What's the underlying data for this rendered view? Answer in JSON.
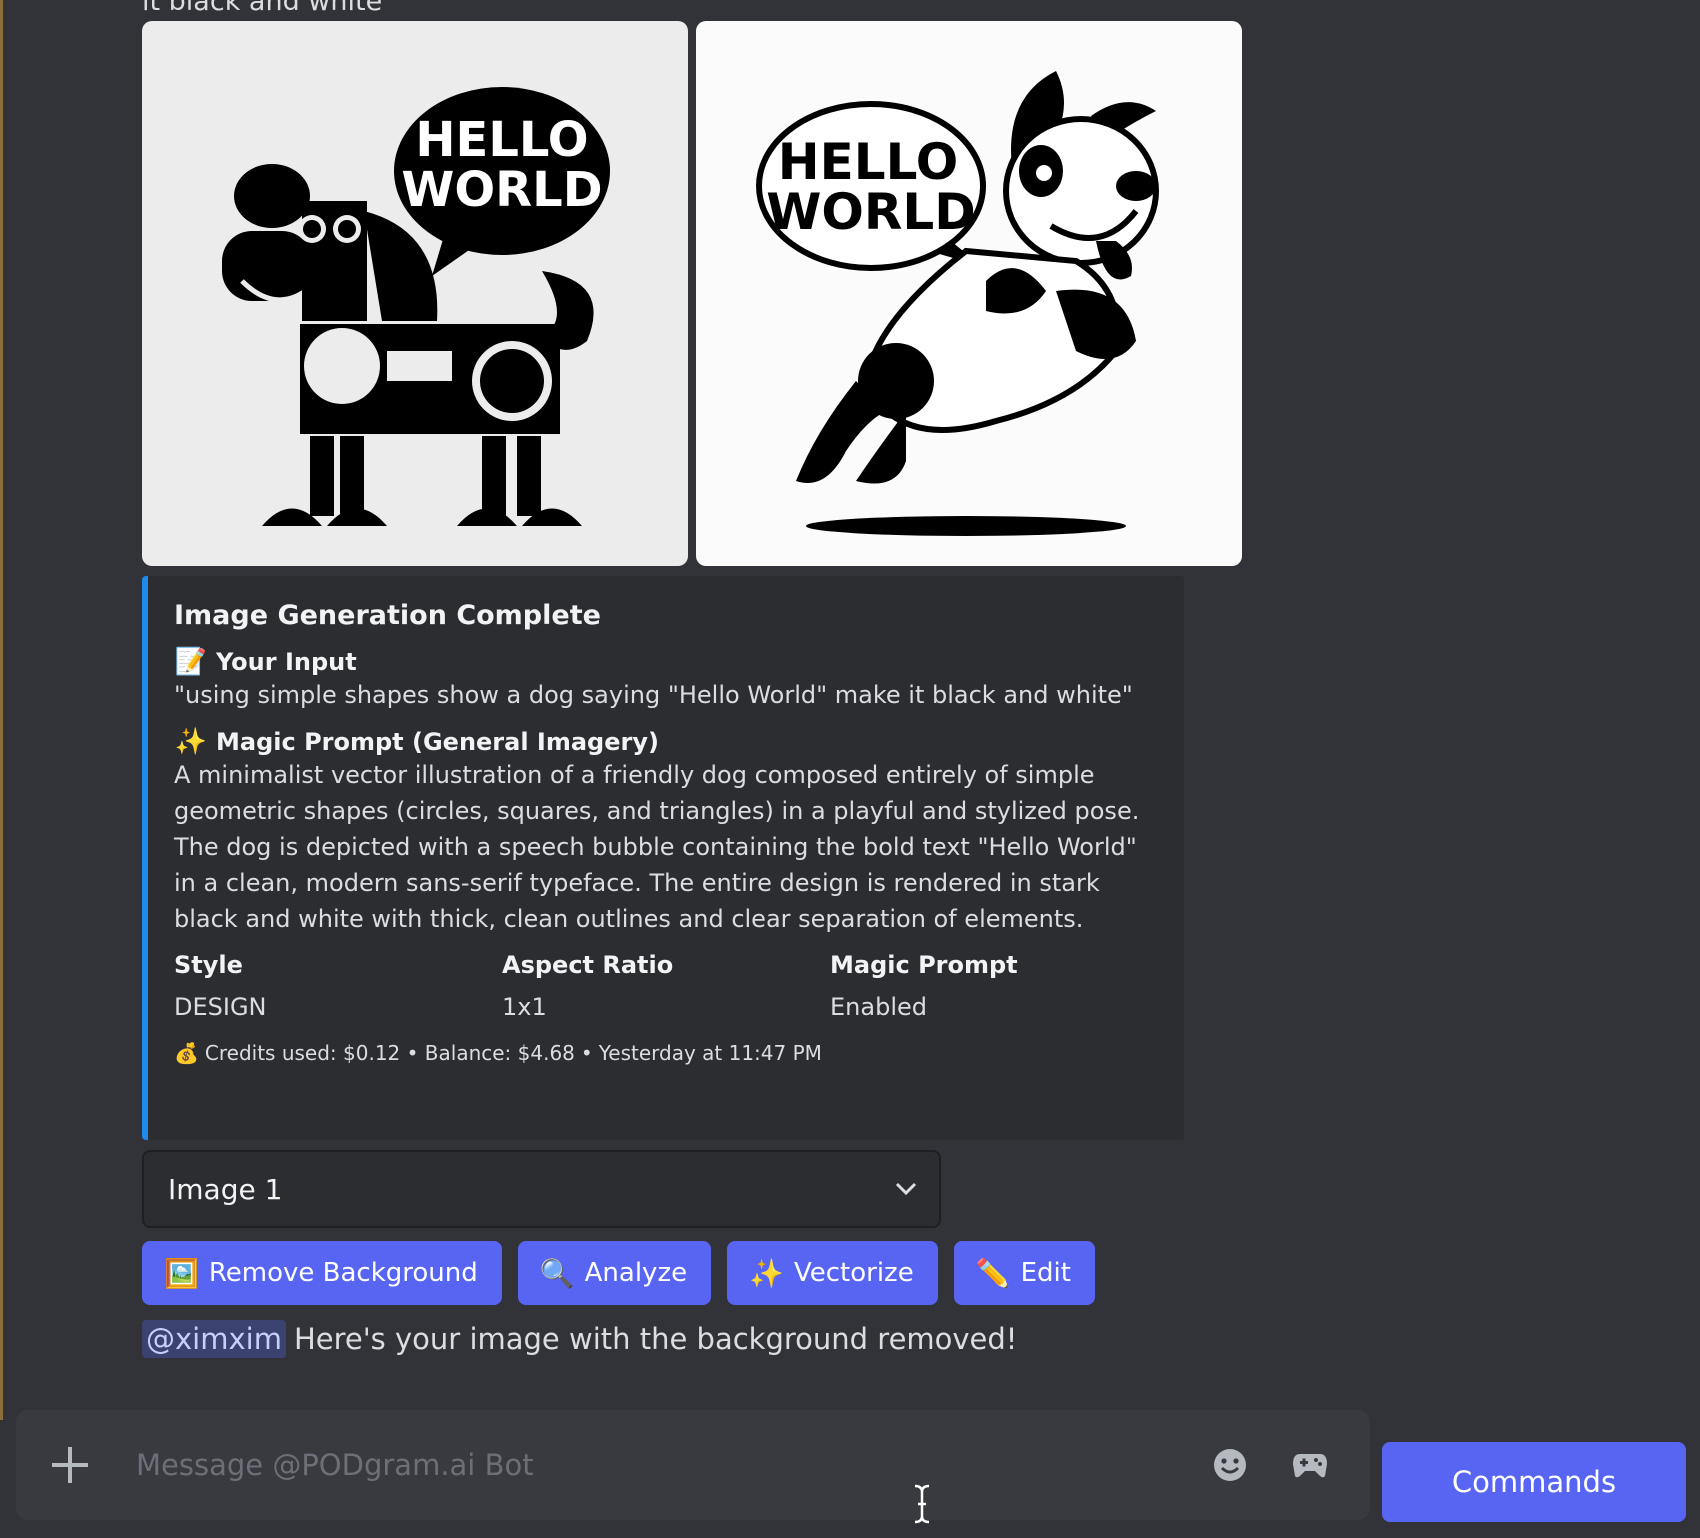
{
  "previous_text_tail": "it black and white",
  "embed": {
    "title": "Image Generation Complete",
    "input": {
      "emoji": "📝",
      "label": "Your Input",
      "value": "\"using simple shapes show a dog saying \"Hello World\" make it black and white\""
    },
    "magic": {
      "emoji": "✨",
      "label": "Magic Prompt (General Imagery)",
      "value": "A minimalist vector illustration of a friendly dog composed entirely of simple geometric shapes (circles, squares, and triangles) in a playful and stylized pose. The dog is depicted with a speech bubble containing the bold text \"Hello World\" in a clean, modern sans-serif typeface. The entire design is rendered in stark black and white with thick, clean outlines and clear separation of elements."
    },
    "fields": [
      {
        "name": "Style",
        "value": "DESIGN"
      },
      {
        "name": "Aspect Ratio",
        "value": "1x1"
      },
      {
        "name": "Magic Prompt",
        "value": "Enabled"
      }
    ],
    "footer": {
      "emoji": "💰",
      "text": "Credits used: $0.12 • Balance: $4.68",
      "time": "Yesterday at 11:47 PM"
    }
  },
  "images": {
    "bubble_text_line1": "HELLO",
    "bubble_text_line2": "WORLD"
  },
  "select": {
    "value": "Image 1"
  },
  "buttons": [
    {
      "icon": "🖼️",
      "label": "Remove Background"
    },
    {
      "icon": "🔍",
      "label": "Analyze"
    },
    {
      "icon": "✨",
      "label": "Vectorize"
    },
    {
      "icon": "✏️",
      "label": "Edit"
    }
  ],
  "message": {
    "mention": "@ximxim",
    "text": "Here's your image with the background removed!"
  },
  "composer": {
    "placeholder": "Message @PODgram.ai Bot"
  },
  "commands_label": "Commands",
  "colors": {
    "accent": "#5865f2",
    "embed_bar": "#1e8bea",
    "background": "#313338"
  }
}
